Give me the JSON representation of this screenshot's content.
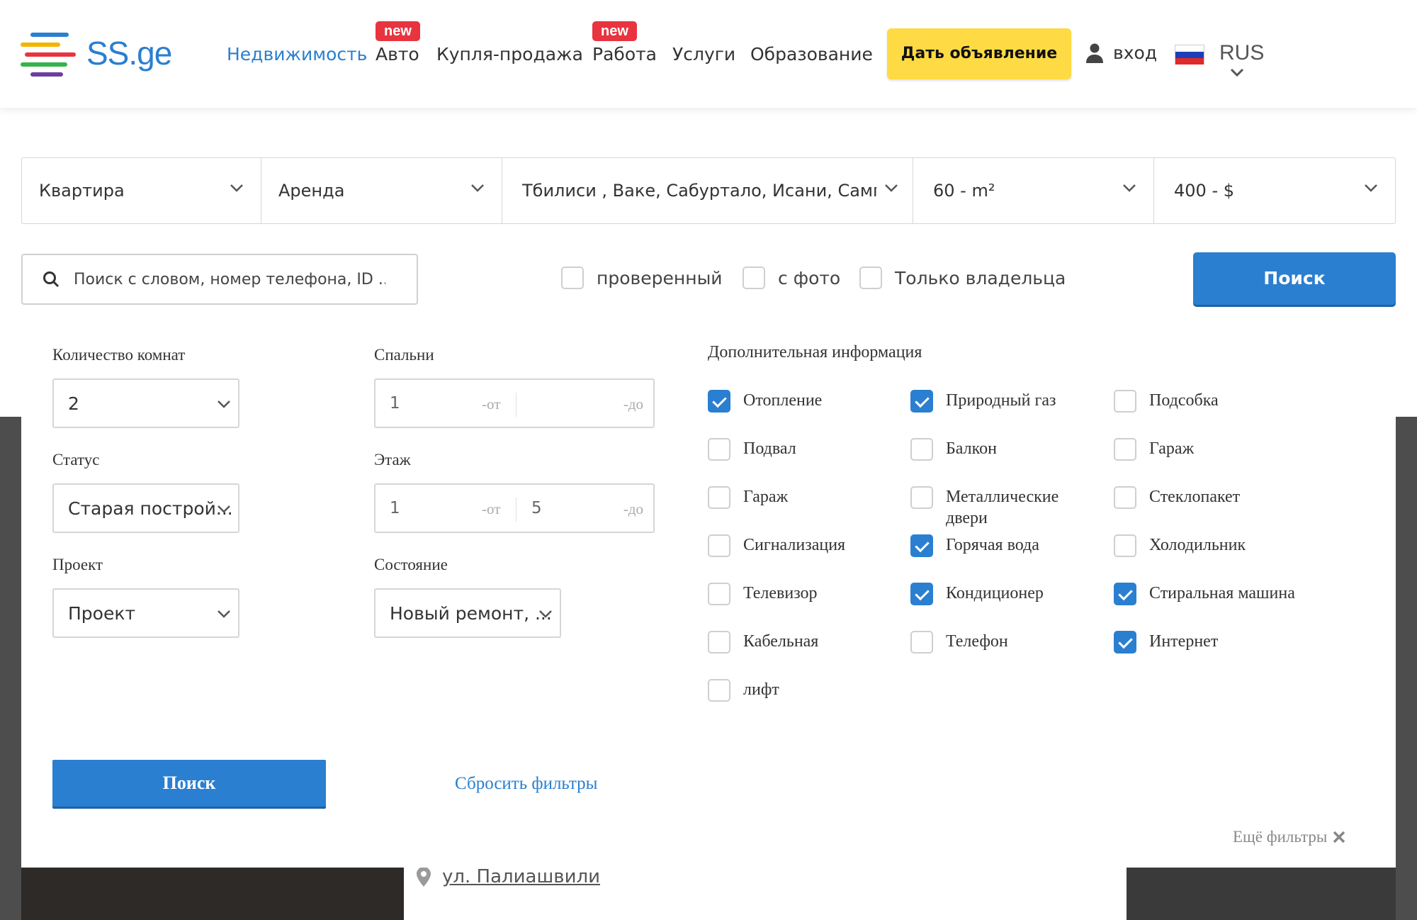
{
  "header": {
    "logo_text": "SS.ge",
    "nav": [
      {
        "label": "Недвижимость"
      },
      {
        "label": "Авто",
        "badge": "new"
      },
      {
        "label": "Купля-продажа"
      },
      {
        "label": "Работа",
        "badge": "new"
      },
      {
        "label": "Услуги"
      },
      {
        "label": "Образование"
      }
    ],
    "post_ad": "Дать объявление",
    "login": "вход",
    "lang": "RUS"
  },
  "filters": {
    "type": "Квартира",
    "deal": "Аренда",
    "location": "Тбилиси , Ваке, Сабуртало, Исани, Самг...",
    "area": "60 - m²",
    "price": "400 - $"
  },
  "search": {
    "placeholder": "Поиск с словом, номер телефона, ID ...",
    "verified": "проверенный",
    "with_photo": "с фото",
    "owner_only": "Только владельца",
    "button": "Поиск"
  },
  "extended": {
    "rooms_label": "Количество комнат",
    "rooms_value": "2",
    "bedrooms_label": "Спальни",
    "bedrooms_from": "1",
    "status_label": "Статус",
    "status_value": "Старая построй...",
    "floor_label": "Этаж",
    "floor_from": "1",
    "floor_to": "5",
    "from_suffix": "-от",
    "to_suffix": "-до",
    "project_label": "Проект",
    "project_value": "Проект",
    "condition_label": "Состояние",
    "condition_value": "Новый ремонт, ...",
    "amenities_title": "Дополнительная информация",
    "amenities": [
      {
        "label": "Отопление",
        "checked": true
      },
      {
        "label": "Природный газ",
        "checked": true
      },
      {
        "label": "Подсобка",
        "checked": false
      },
      {
        "label": "Подвал",
        "checked": false
      },
      {
        "label": "Балкон",
        "checked": false
      },
      {
        "label": "Гараж",
        "checked": false
      },
      {
        "label": "Гараж",
        "checked": false
      },
      {
        "label": "Металлические двери",
        "checked": false
      },
      {
        "label": "Стеклопакет",
        "checked": false
      },
      {
        "label": "Сигнализация",
        "checked": false
      },
      {
        "label": "Горячая вода",
        "checked": true
      },
      {
        "label": "Холодильник",
        "checked": false
      },
      {
        "label": "Телевизор",
        "checked": false
      },
      {
        "label": "Кондиционер",
        "checked": true
      },
      {
        "label": "Стиральная машина",
        "checked": true
      },
      {
        "label": "Кабельная",
        "checked": false
      },
      {
        "label": "Телефон",
        "checked": false
      },
      {
        "label": "Интернет",
        "checked": true
      },
      {
        "label": "лифт",
        "checked": false
      }
    ],
    "search_button": "Поиск",
    "reset": "Сбросить фильтры",
    "more_filters": "Ещё фильтры"
  },
  "listing": {
    "address": "ул. Палиашвили"
  },
  "colors": {
    "brand_blue": "#2a7fd0",
    "yellow": "#fedb44",
    "badge_red": "#e8343f"
  }
}
